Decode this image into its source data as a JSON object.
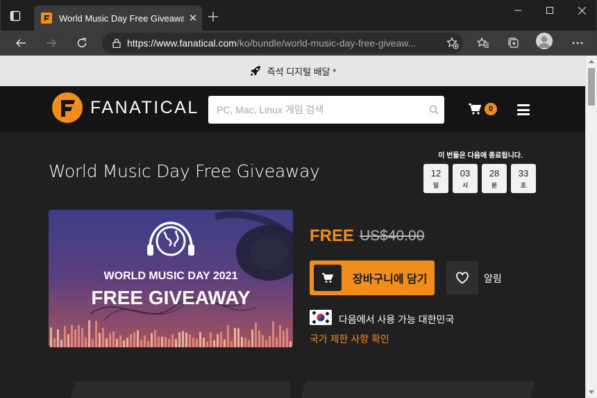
{
  "browser": {
    "tab_title": "World Music Day Free Giveaway",
    "tab_close": "✕",
    "url_host": "https://www.fanatical.com",
    "url_path": "/ko/bundle/world-music-day-free-giveaw..."
  },
  "promo": {
    "text": "즉석 디지털 배달 *"
  },
  "header": {
    "logo_text": "FANATICAL",
    "search_placeholder": "PC, Mac, Linux 게임 검색",
    "cart_count": "0"
  },
  "product": {
    "title": "World Music Day Free Giveaway",
    "countdown_label": "이 번들은 다음에 종료됩니다.",
    "countdown": [
      {
        "value": "12",
        "unit": "일"
      },
      {
        "value": "03",
        "unit": "시"
      },
      {
        "value": "28",
        "unit": "분"
      },
      {
        "value": "33",
        "unit": "초"
      }
    ],
    "hero": {
      "line1": "WORLD MUSIC DAY 2021",
      "line2": "FREE GIVEAWAY"
    },
    "price": "FREE",
    "original_price": "US$40.00",
    "add_to_cart": "장바구니에 담기",
    "wishlist_label": "알림",
    "region_text": "다음에서 사용 가능 대한민국",
    "region_link": "국가 제한 사항 확인"
  },
  "colors": {
    "accent": "#f28c1a",
    "page_bg": "#202020",
    "header_bg": "#141414"
  }
}
